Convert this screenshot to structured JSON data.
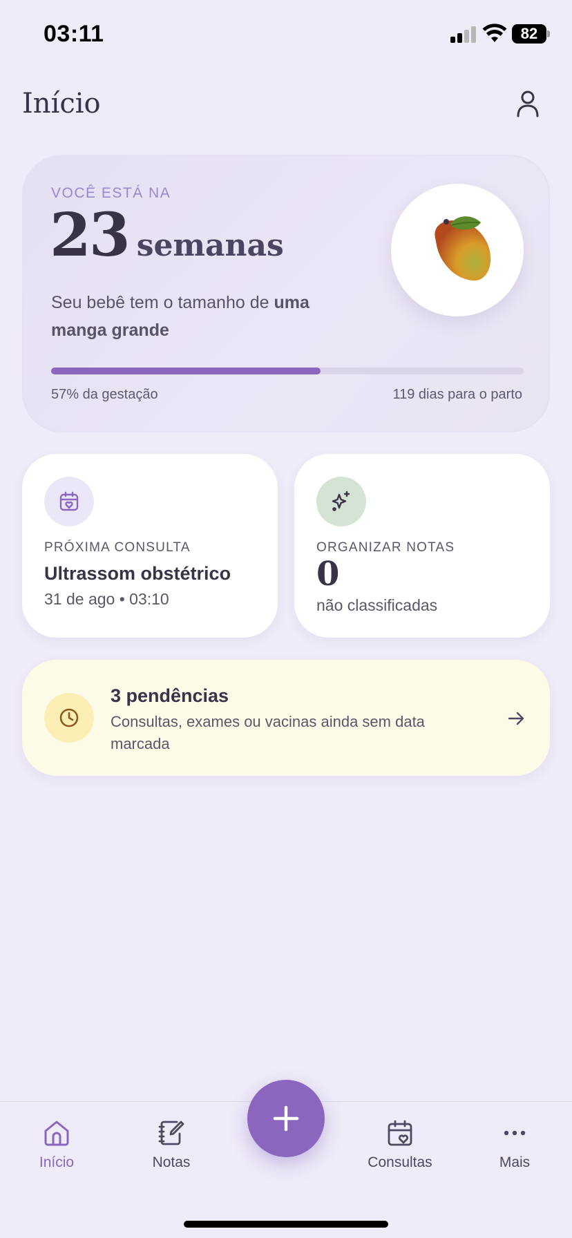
{
  "status_bar": {
    "time": "03:11",
    "battery": "82"
  },
  "header": {
    "title": "Início",
    "profile_icon": "person-icon"
  },
  "hero": {
    "eyebrow": "VOCÊ ESTÁ NA",
    "weeks": "23",
    "unit": "semanas",
    "desc_prefix": "Seu bebê tem o tamanho de ",
    "desc_fruit": "uma manga grande",
    "fruit_icon": "mango-image",
    "progress_fraction": 0.57,
    "progress_left": "57% da gestação",
    "progress_right": "119 dias para o parto"
  },
  "cards": {
    "appointment": {
      "icon": "calendar-heart-icon",
      "eyebrow": "PRÓXIMA CONSULTA",
      "title": "Ultrassom obstétrico",
      "subtitle": "31 de ago • 03:10"
    },
    "notes": {
      "icon": "sparkles-icon",
      "eyebrow": "ORGANIZAR NOTAS",
      "count": "0",
      "subtitle": "não classificadas"
    }
  },
  "pending": {
    "icon": "clock-icon",
    "title": "3 pendências",
    "description": "Consultas, exames ou vacinas ainda sem data marcada"
  },
  "tabbar": {
    "items": [
      {
        "label": "Início",
        "icon": "home-icon",
        "active": true
      },
      {
        "label": "Notas",
        "icon": "notes-icon",
        "active": false
      },
      {
        "label": "Consultas",
        "icon": "calendar-heart-icon",
        "active": false
      },
      {
        "label": "Mais",
        "icon": "more-icon",
        "active": false
      }
    ],
    "fab_icon": "plus-icon"
  },
  "colors": {
    "accent": "#8a66bf",
    "background": "#efebf8",
    "pending_bg": "#fdfae8",
    "appointment_icon_bg": "#ece7f6",
    "notes_icon_bg": "#d4e3d3"
  }
}
